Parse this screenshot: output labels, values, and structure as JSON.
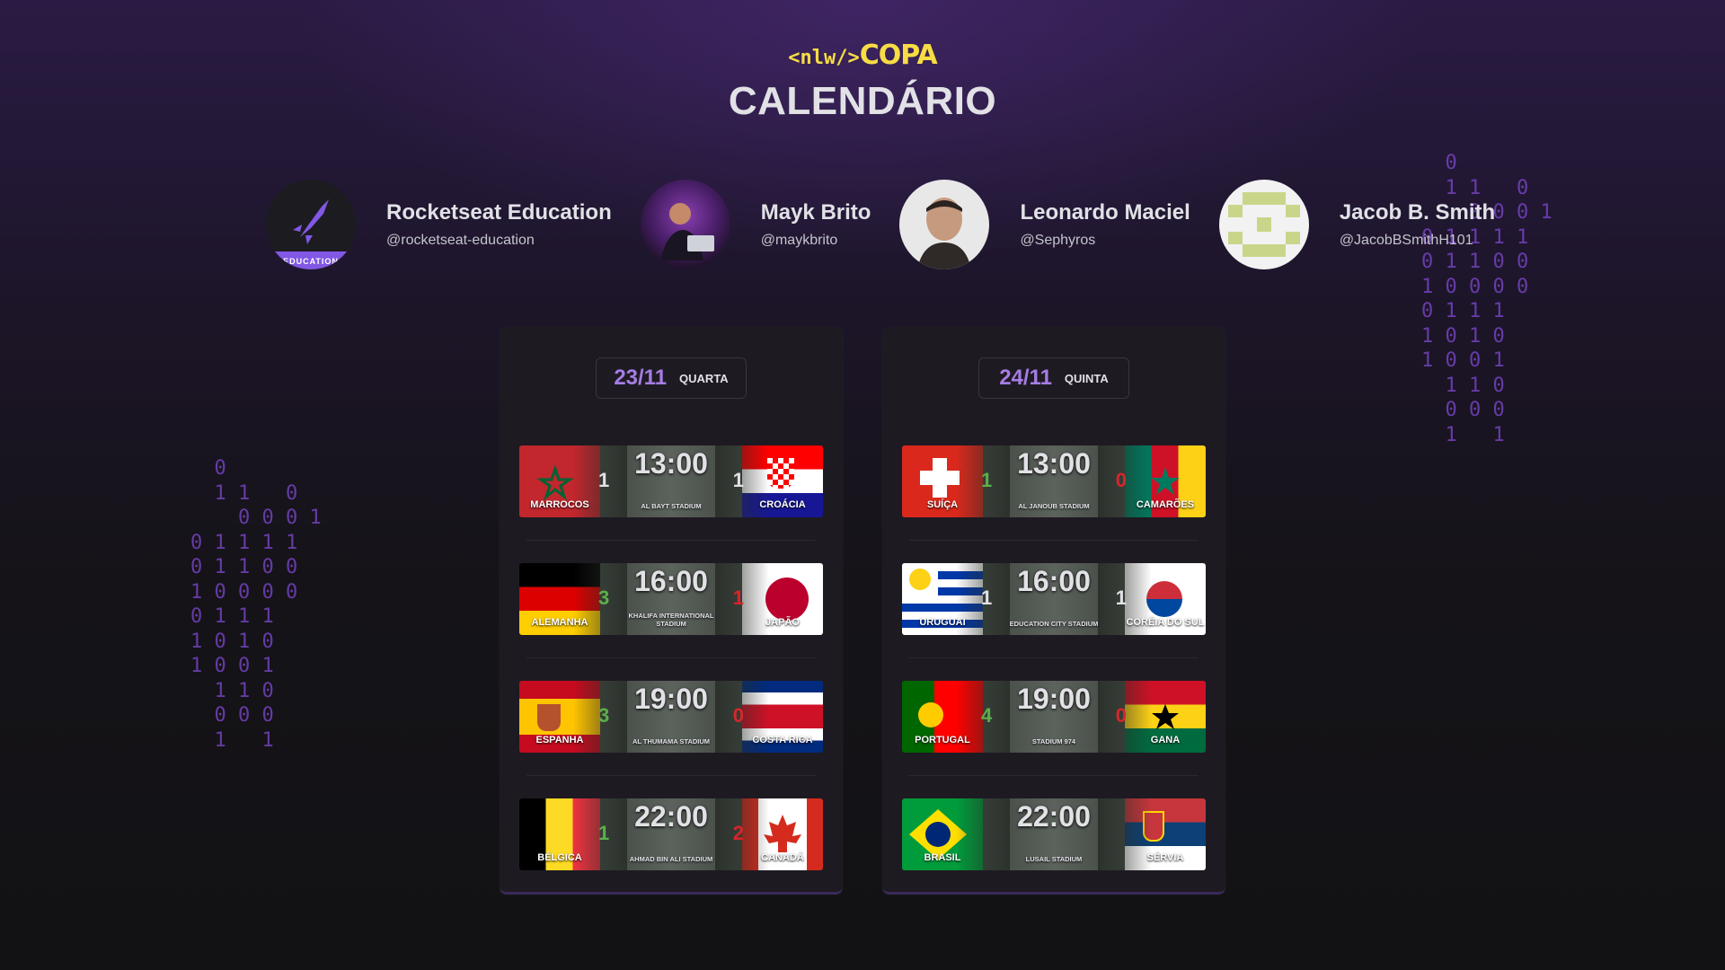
{
  "header": {
    "logo_code": "<nlw/>",
    "logo_copa": "COPA",
    "title": "CALENDÁRIO"
  },
  "authors": [
    {
      "name": "Rocketseat Education",
      "handle": "@rocketseat-education",
      "avatar_label": "EDUCATION"
    },
    {
      "name": "Mayk Brito",
      "handle": "@maykbrito"
    },
    {
      "name": "Leonardo Maciel",
      "handle": "@Sephyros"
    },
    {
      "name": "Jacob B. Smith",
      "handle": "@JacobBSmithH101"
    }
  ],
  "days": [
    {
      "date": "23/11",
      "weekday": "QUARTA",
      "matches": [
        {
          "time": "13:00",
          "stadium": "AL BAYT STADIUM",
          "home": "MARROCOS",
          "away": "CROÁCIA",
          "home_score": "1",
          "away_score": "1"
        },
        {
          "time": "16:00",
          "stadium": "KHALIFA INTERNATIONAL STADIUM",
          "home": "ALEMANHA",
          "away": "JAPÃO",
          "home_score": "3",
          "away_score": "1"
        },
        {
          "time": "19:00",
          "stadium": "AL THUMAMA STADIUM",
          "home": "ESPANHA",
          "away": "COSTA RICA",
          "home_score": "3",
          "away_score": "0"
        },
        {
          "time": "22:00",
          "stadium": "AHMAD BIN ALI STADIUM",
          "home": "BÉLGICA",
          "away": "CANADÁ",
          "home_score": "1",
          "away_score": "2"
        }
      ]
    },
    {
      "date": "24/11",
      "weekday": "QUINTA",
      "matches": [
        {
          "time": "13:00",
          "stadium": "AL JANOUB STADIUM",
          "home": "SUÍÇA",
          "away": "CAMARÕES",
          "home_score": "1",
          "away_score": "0"
        },
        {
          "time": "16:00",
          "stadium": "EDUCATION CITY STADIUM",
          "home": "URUGUAI",
          "away": "CORÉIA DO SUL",
          "home_score": "1",
          "away_score": "1"
        },
        {
          "time": "19:00",
          "stadium": "STADIUM 974",
          "home": "PORTUGAL",
          "away": "GANA",
          "home_score": "4",
          "away_score": "0"
        },
        {
          "time": "22:00",
          "stadium": "LUSAIL STADIUM",
          "home": "BRASIL",
          "away": "SÉRVIA",
          "home_score": "",
          "away_score": ""
        }
      ]
    }
  ],
  "binary_rain": {
    "left": "  0\n  1 1   0\n    0 0 0 1\n0 1 1 1 1\n0 1 1 0 0\n1 0 0 0 0\n0 1 1 1\n1 0 1 0\n1 0 0 1\n  1 1 0\n  0 0 0\n  1   1",
    "right": "  0\n  1 1   0\n    0 0 0 1\n0 1 1 1 1\n0 1 1 0 0\n1 0 0 0 0\n0 1 1 1\n1 0 1 0\n1 0 0 1\n  1 1 0\n  0 0 0\n  1   1"
  },
  "colors": {
    "accent": "#a57de4",
    "logo": "#f7dd43",
    "win": "#5bb04a",
    "lose": "#d6262a",
    "card": "#1e1a22"
  }
}
